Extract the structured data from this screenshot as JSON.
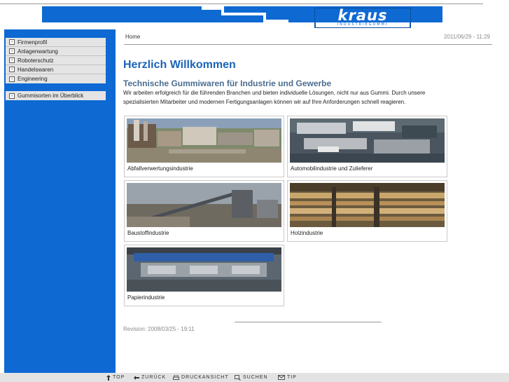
{
  "header": {
    "logo_text": "kraus",
    "logo_subtext": "INDUSTRIEGUMMI"
  },
  "sidebar": {
    "group1": [
      {
        "label": "Firmenprofil"
      },
      {
        "label": "Anlagenwartung"
      },
      {
        "label": "Roboterschutz"
      },
      {
        "label": "Handelswaren"
      },
      {
        "label": "Engineering"
      }
    ],
    "group2": [
      {
        "label": "Gummisorten im Überblick"
      }
    ]
  },
  "content": {
    "breadcrumb": "Home",
    "date": "2011/06/29 - 11:29",
    "title": "Herzlich Willkommen",
    "subtitle": "Technische Gummiwaren für Industrie und Gewerbe",
    "intro": "Wir arbeiten erfolgreich für die führenden Branchen und bieten individuelle Lösungen, nicht nur aus Gummi.  Durch unsere spezialisierten Mitarbeiter und modernen Fertigungsanlagen können wir auf Ihre Anforderungen schnell reagieren.",
    "industries": [
      {
        "label": "Abfallverwertungsindustrie"
      },
      {
        "label": "Automobilindustrie und Zulieferer"
      },
      {
        "label": "Baustoffindustrie"
      },
      {
        "label": "Holzindustrie"
      },
      {
        "label": "Papierindustrie"
      }
    ],
    "revision": "Revision: 2008/03/25 - 19:11"
  },
  "footer": {
    "top": "TOP",
    "back": "ZURÜCK",
    "print": "DRUCKANSICHT",
    "search": "SUCHEN",
    "tip": "TIP"
  },
  "colors": {
    "brand_blue": "#0e69d3",
    "title_blue": "#1b63b8",
    "nav_bg": "#e4e4e4"
  }
}
